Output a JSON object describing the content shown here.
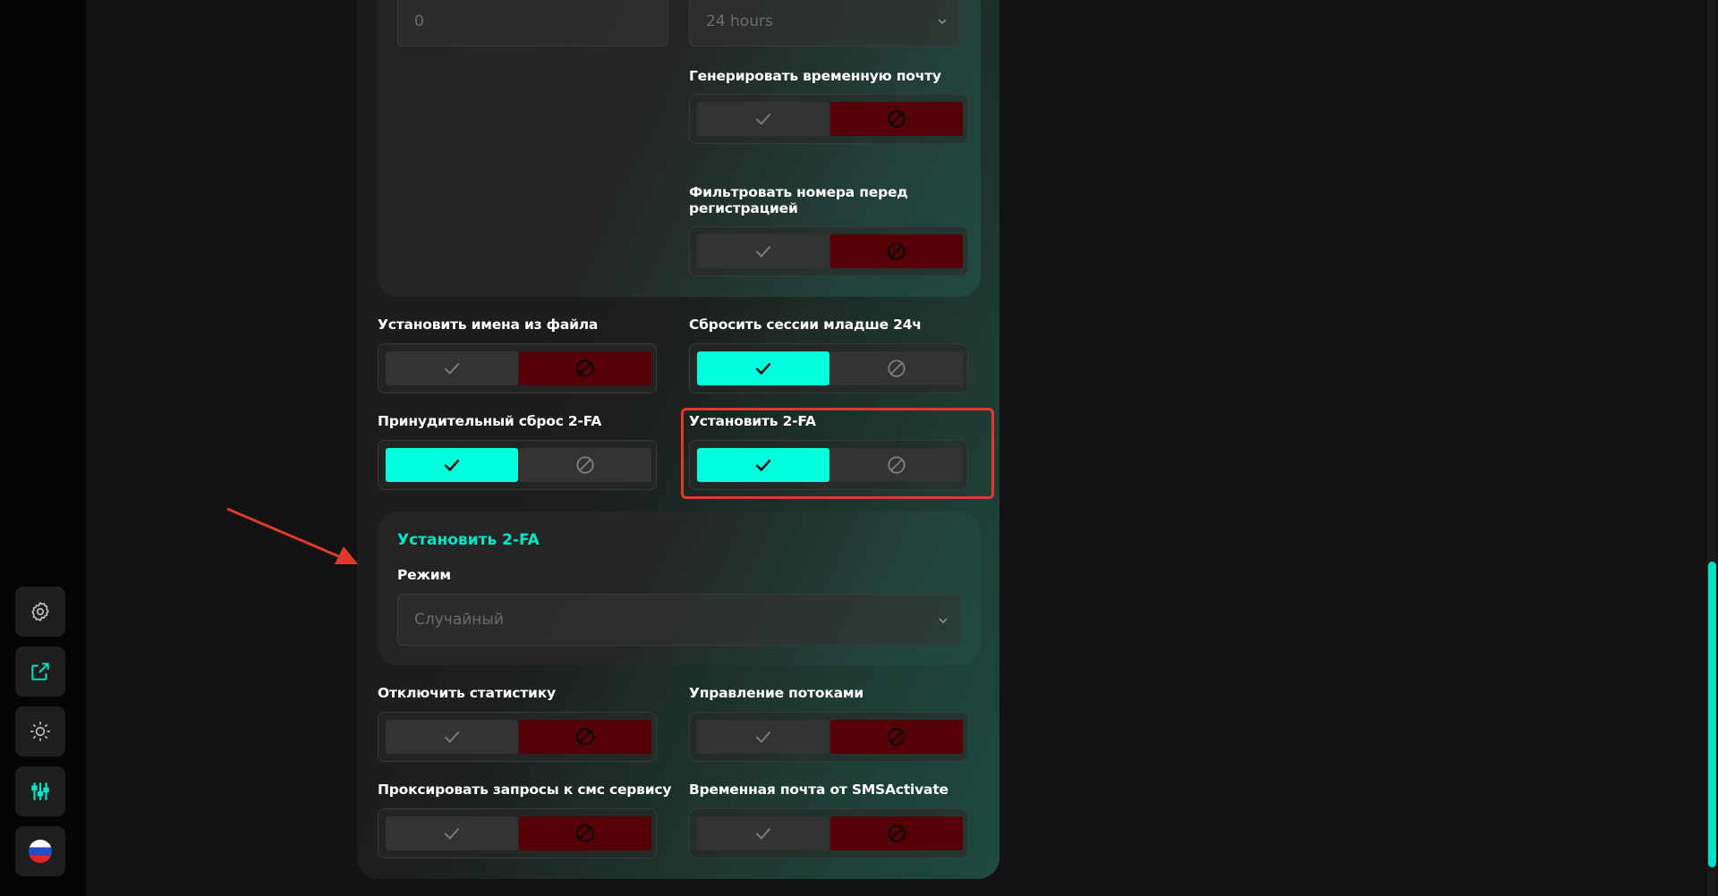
{
  "top_fields": {
    "number_value": "0",
    "duration_value": "24 hours"
  },
  "settings": {
    "gen_temp_mail": "Генерировать временную почту",
    "filter_numbers": "Фильтровать номера перед регистрацией",
    "set_names": "Установить имена из файла",
    "reset_sessions": "Сбросить сессии младше 24ч",
    "force_reset_2fa": "Принудительный сброс 2-FA",
    "set_2fa": "Установить 2-FA",
    "disable_stats": "Отключить статистику",
    "thread_control": "Управление потоками",
    "proxy_sms": "Проксировать запросы к смс сервису",
    "temp_mail_sms": "Временная почта от SMSActivate"
  },
  "two_fa_section": {
    "title": "Установить 2-FA",
    "mode_label": "Режим",
    "mode_value": "Случайный"
  },
  "toggle_states": {
    "gen_temp_mail": false,
    "filter_numbers": false,
    "set_names": false,
    "reset_sessions": true,
    "force_reset_2fa": true,
    "set_2fa": true,
    "disable_stats": false,
    "thread_control": false,
    "proxy_sms": false,
    "temp_mail_sms": false
  },
  "sidebar_icons": [
    "gear-icon",
    "external-link-icon",
    "sun-icon",
    "sliders-icon",
    "russia-flag-icon"
  ],
  "colors": {
    "accent": "#00ffdd",
    "disabled_active": "#560008",
    "highlight": "#e03a2e"
  }
}
